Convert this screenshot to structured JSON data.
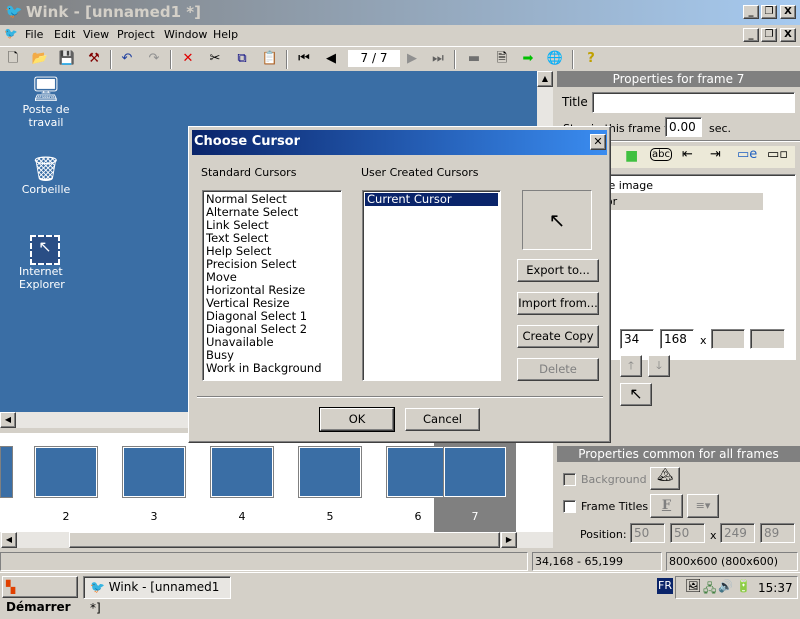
{
  "window": {
    "title": "Wink - [unnamed1 *]"
  },
  "menu": [
    "File",
    "Edit",
    "View",
    "Project",
    "Window",
    "Help"
  ],
  "toolbar": {
    "frame_counter": "7 / 7",
    "icons": [
      "new-icon",
      "open-icon",
      "save-icon",
      "render-icon",
      "undo-icon",
      "redo-icon",
      "delete-icon",
      "cut-icon",
      "copy-icon",
      "paste-icon",
      "first-frame-icon",
      "prev-frame-icon",
      "next-frame-icon",
      "last-frame-icon",
      "frame-icon",
      "preview-icon",
      "go-icon",
      "browser-icon",
      "help-icon"
    ]
  },
  "desktop": {
    "icons": [
      {
        "label": "Poste de travail"
      },
      {
        "label": "Corbeille"
      },
      {
        "label": "Internet Explorer"
      }
    ]
  },
  "frame_props": {
    "header": "Properties for frame 7",
    "title_label": "Title",
    "title_value": "",
    "stay_label": "Stay in this frame for",
    "stay_value": "0.00",
    "stay_unit": "sec.",
    "items": [
      "Frame image",
      "Cursor"
    ],
    "x": "34",
    "y": "168",
    "x_sep": "x",
    "w": "",
    "h": ""
  },
  "common_props": {
    "header": "Properties common for all frames",
    "background_label": "Background",
    "background_checked": false,
    "frame_titles_label": "Frame Titles",
    "frame_titles_checked": false,
    "font_button": "F",
    "position_label": "Position:",
    "pos": [
      "50",
      "50",
      "249",
      "89"
    ],
    "x_sep": "x"
  },
  "filmstrip": {
    "frames": [
      "2",
      "3",
      "4",
      "5",
      "6",
      "7"
    ],
    "selected": "7"
  },
  "statusbar": {
    "main": "",
    "coords": "34,168 - 65,199",
    "size": "800x600 (800x600)"
  },
  "taskbar": {
    "start": "Démarrer",
    "task": "Wink - [unnamed1 *]",
    "lang": "FR",
    "clock": "15:37"
  },
  "dialog": {
    "title": "Choose Cursor",
    "standard_label": "Standard Cursors",
    "standard": [
      "Normal Select",
      "Alternate Select",
      "Link Select",
      "Text Select",
      "Help Select",
      "Precision Select",
      "Move",
      "Horizontal Resize",
      "Vertical Resize",
      "Diagonal Select 1",
      "Diagonal Select 2",
      "Unavailable",
      "Busy",
      "Work in Background"
    ],
    "user_label": "User Created Cursors",
    "user": [
      "Current Cursor"
    ],
    "selected_user": "Current Cursor",
    "export": "Export to...",
    "import": "Import from...",
    "copy": "Create Copy",
    "delete": "Delete",
    "ok": "OK",
    "cancel": "Cancel"
  },
  "colors": {
    "desktop": "#3a6ea5",
    "selection": "#0a246a",
    "header": "#808080"
  }
}
